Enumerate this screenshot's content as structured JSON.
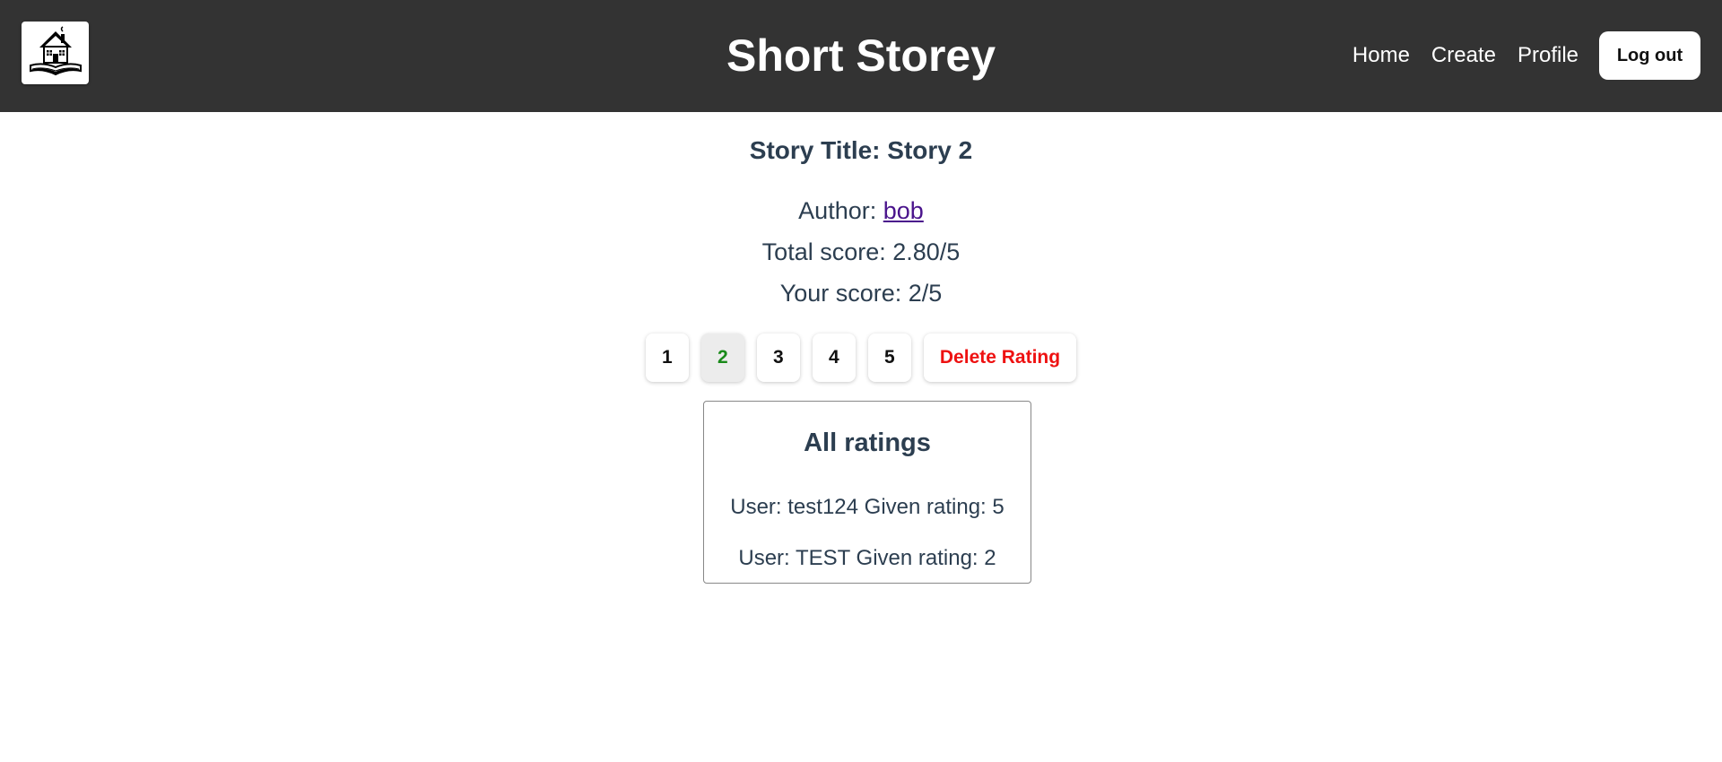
{
  "header": {
    "site_title": "Short Storey",
    "logo_icon": "house-on-book-icon",
    "nav": [
      {
        "label": "Home"
      },
      {
        "label": "Create"
      },
      {
        "label": "Profile"
      }
    ],
    "logout_label": "Log out"
  },
  "story": {
    "title": "Story Title: Story 2",
    "author_prefix": "Author:",
    "author_name": "bob",
    "total_score": "Total score: 2.80/5",
    "your_score": "Your score: 2/5"
  },
  "rating_controls": {
    "options": [
      "1",
      "2",
      "3",
      "4",
      "5"
    ],
    "selected": "2",
    "delete_label": "Delete Rating"
  },
  "all_ratings": {
    "heading": "All ratings",
    "items": [
      {
        "text": "User: test124 Given rating: 5"
      },
      {
        "text": "User: TEST Given rating: 2"
      }
    ]
  },
  "colors": {
    "header_bg": "#333333",
    "text": "#2c3e50",
    "selected_rating": "#1a8a1a",
    "delete": "#ee1111",
    "author_link": "#4a148c"
  }
}
